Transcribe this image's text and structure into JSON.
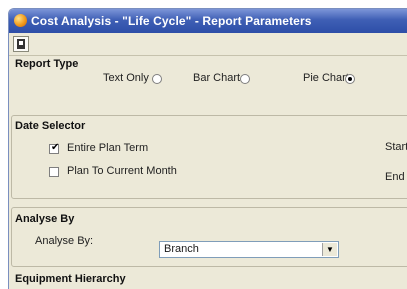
{
  "window": {
    "title": "Cost Analysis - \"Life Cycle\" - Report Parameters"
  },
  "toolbar": {
    "icon": "page-icon"
  },
  "report_type": {
    "title": "Report Type",
    "options": [
      {
        "label": "Text Only",
        "selected": false
      },
      {
        "label": "Bar Chart",
        "selected": false
      },
      {
        "label": "Pie Chart",
        "selected": true
      }
    ]
  },
  "date_selector": {
    "title": "Date Selector",
    "entire_plan_term": {
      "label": "Entire Plan Term",
      "checked": true
    },
    "plan_to_current_month": {
      "label": "Plan To Current Month",
      "checked": false
    },
    "start_label": "Start",
    "end_label": "End"
  },
  "analyse_by": {
    "title": "Analyse By",
    "field_label": "Analyse By:",
    "value": "Branch"
  },
  "equipment_hierarchy": {
    "title": "Equipment Hierarchy"
  }
}
